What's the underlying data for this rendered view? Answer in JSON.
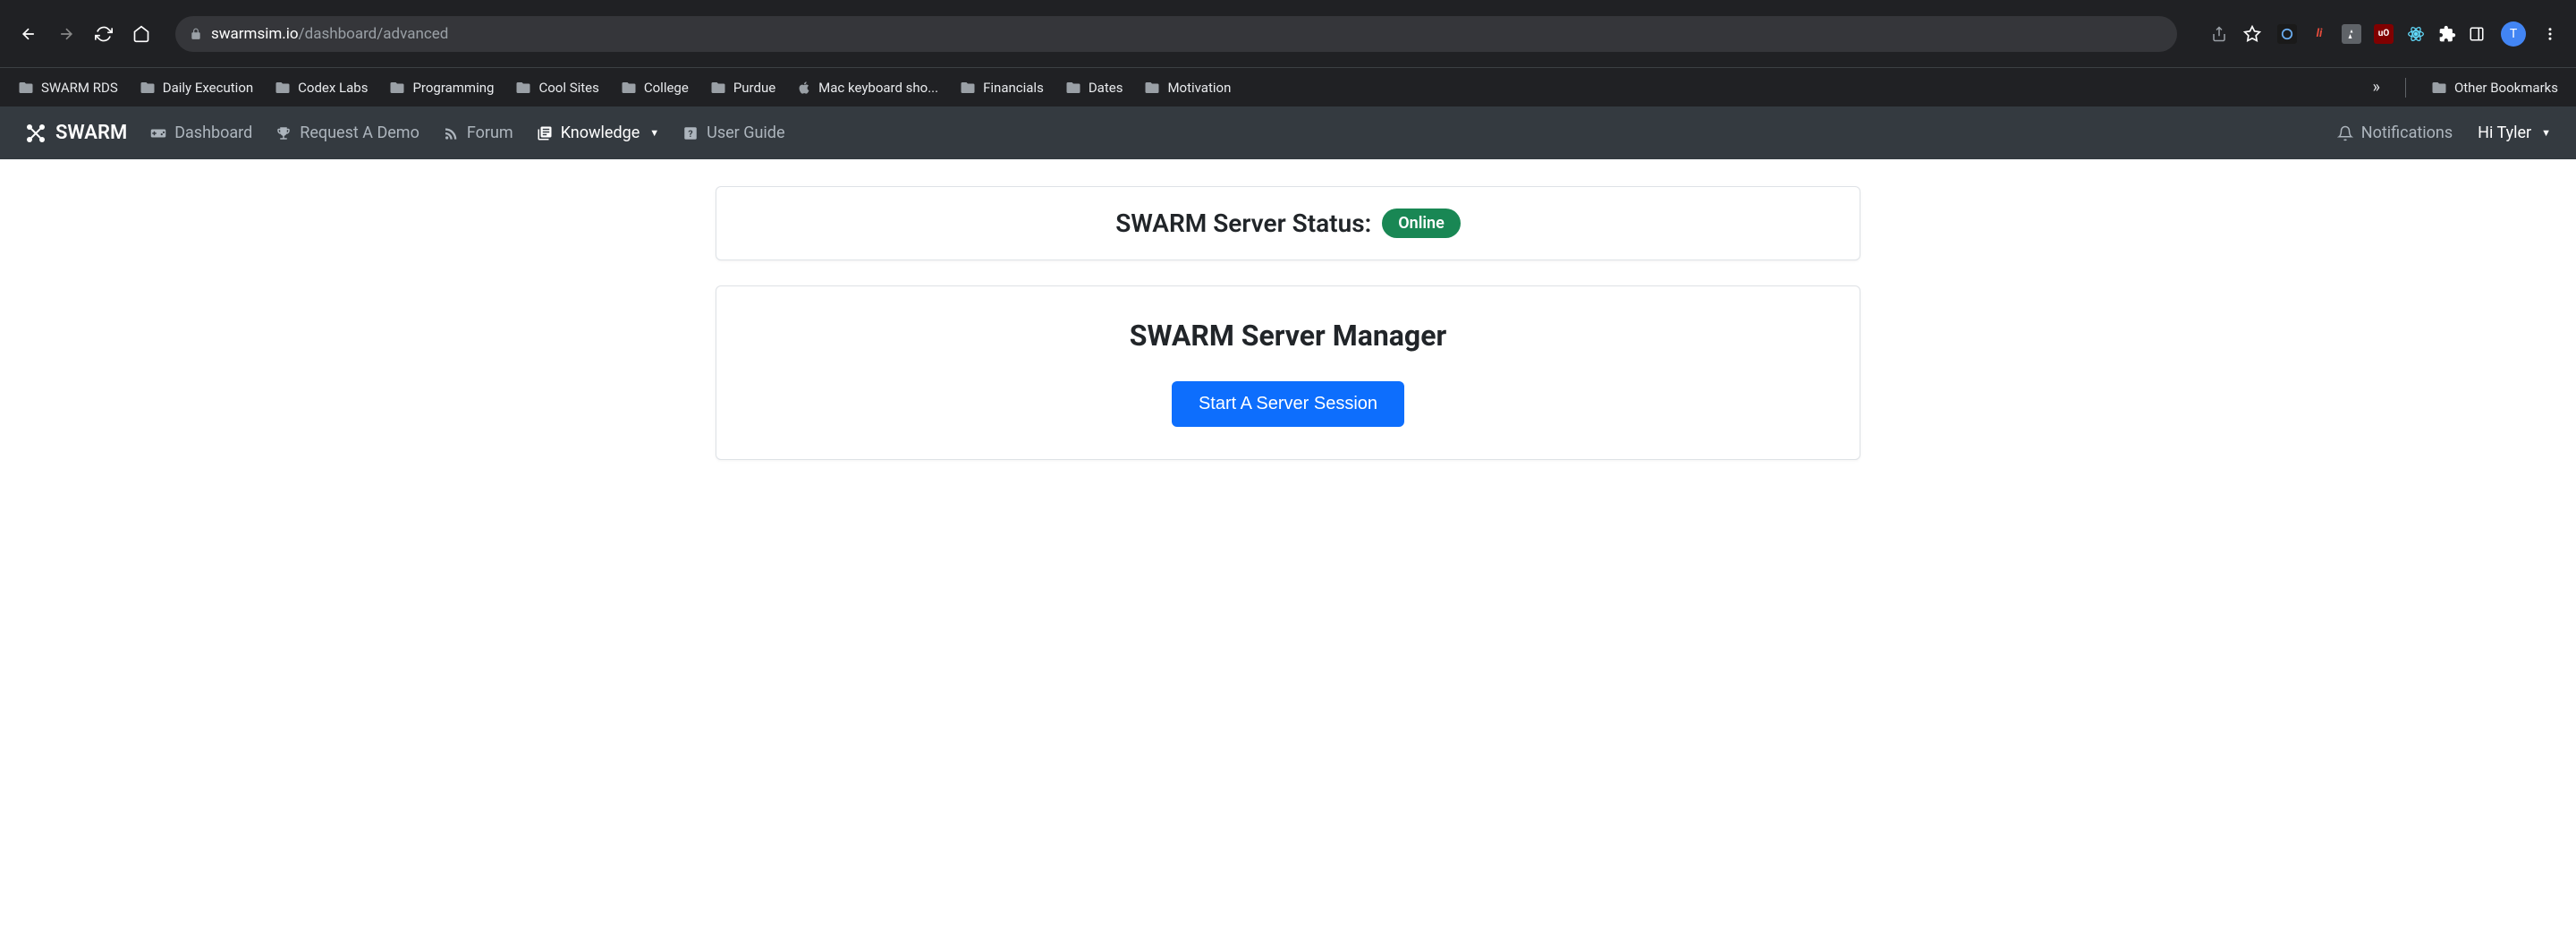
{
  "browser": {
    "url_host": "swarmsim.io",
    "url_path": "/dashboard/advanced",
    "profile_initial": "T",
    "other_bookmarks": "Other Bookmarks",
    "overflow_glyph": "»"
  },
  "bookmarks": [
    {
      "label": "SWARM RDS",
      "icon": "folder"
    },
    {
      "label": "Daily Execution",
      "icon": "folder"
    },
    {
      "label": "Codex Labs",
      "icon": "folder"
    },
    {
      "label": "Programming",
      "icon": "folder"
    },
    {
      "label": "Cool Sites",
      "icon": "folder"
    },
    {
      "label": "College",
      "icon": "folder"
    },
    {
      "label": "Purdue",
      "icon": "folder"
    },
    {
      "label": "Mac keyboard sho...",
      "icon": "apple"
    },
    {
      "label": "Financials",
      "icon": "folder"
    },
    {
      "label": "Dates",
      "icon": "folder"
    },
    {
      "label": "Motivation",
      "icon": "folder"
    }
  ],
  "navbar": {
    "brand": "SWARM",
    "items": [
      {
        "label": "Dashboard",
        "icon": "gamepad",
        "active": false
      },
      {
        "label": "Request A Demo",
        "icon": "trophy",
        "active": false
      },
      {
        "label": "Forum",
        "icon": "rss",
        "active": false
      },
      {
        "label": "Knowledge",
        "icon": "books",
        "active": true,
        "dropdown": true
      },
      {
        "label": "User Guide",
        "icon": "question",
        "active": false
      }
    ],
    "notifications": "Notifications",
    "greeting": "Hi Tyler"
  },
  "status": {
    "label": "SWARM Server Status:",
    "badge": "Online"
  },
  "manager": {
    "title": "SWARM Server Manager",
    "button": "Start A Server Session"
  }
}
